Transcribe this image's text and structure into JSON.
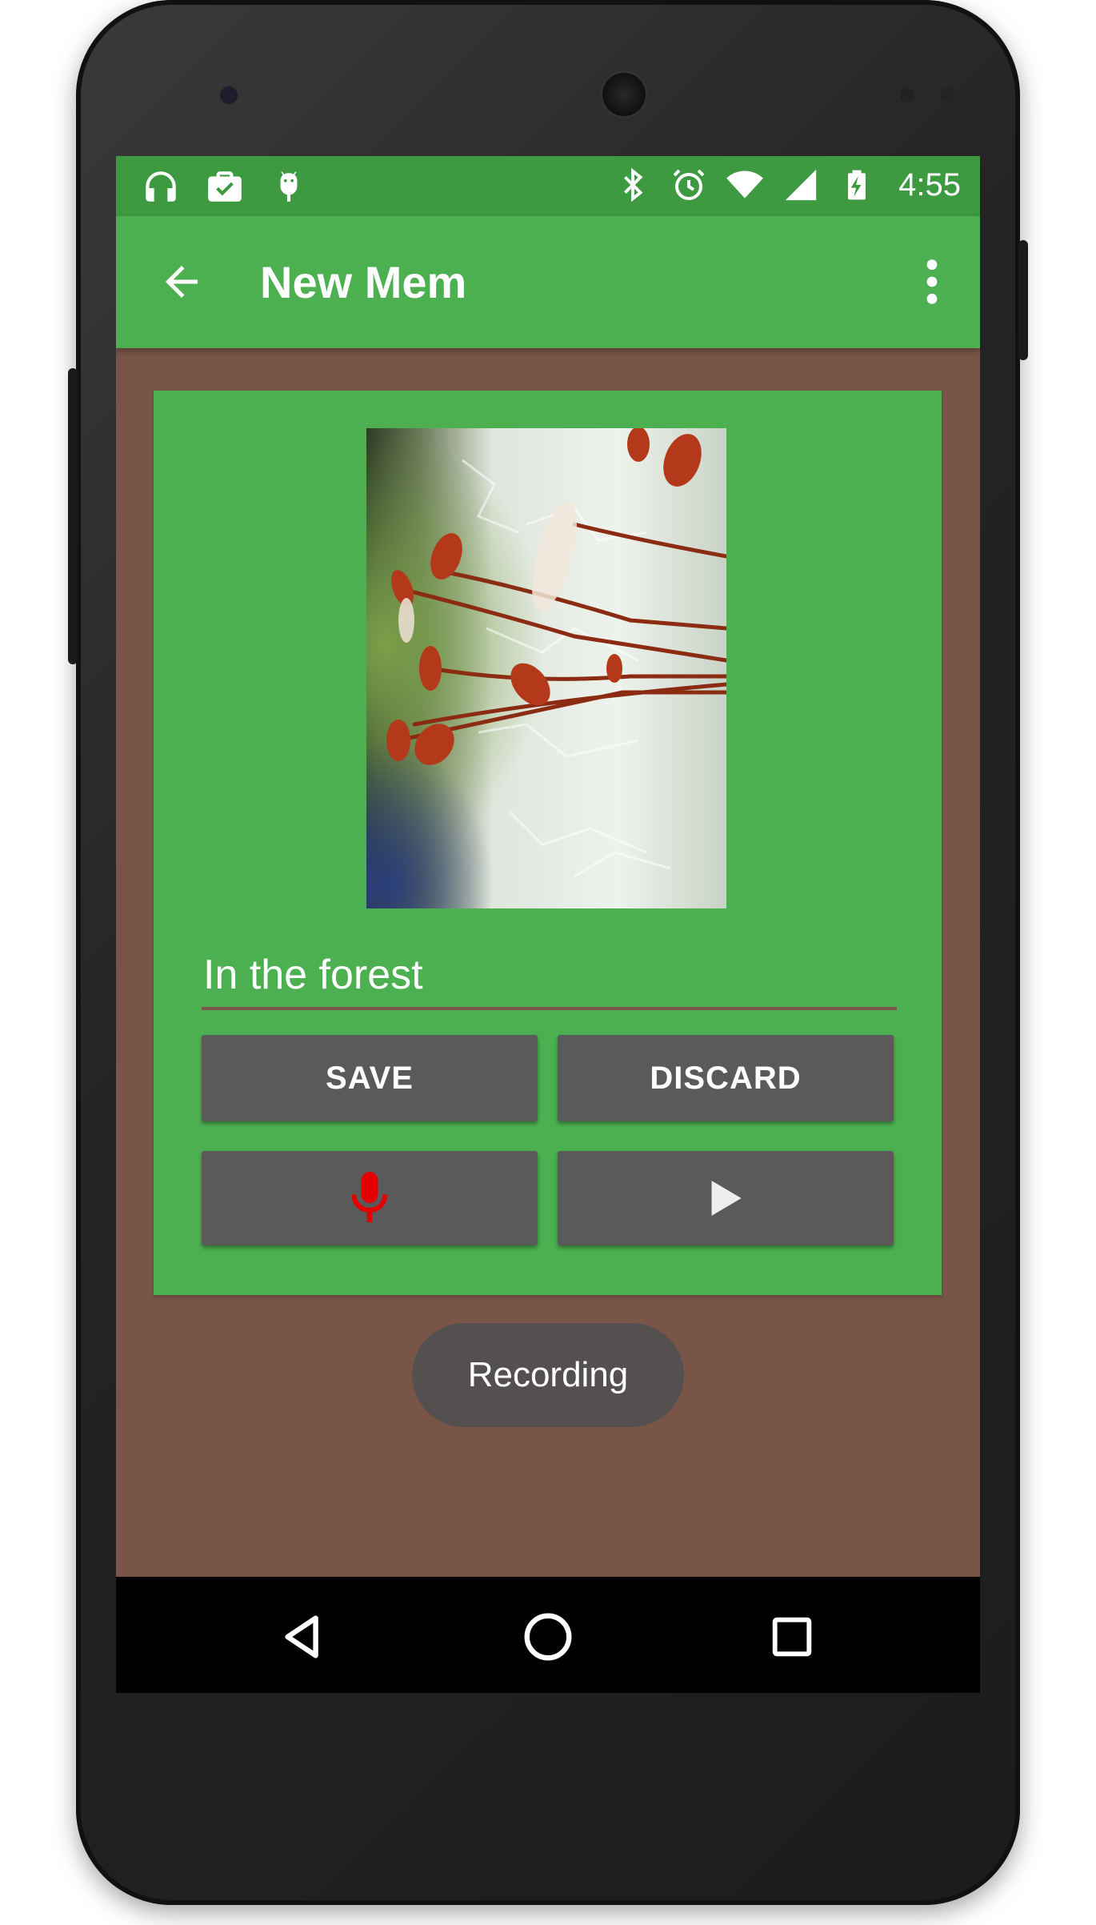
{
  "status_bar": {
    "time": "4:55",
    "left_icons": [
      "headphones-icon",
      "briefcase-check-icon",
      "android-icon"
    ],
    "right_icons": [
      "bluetooth-icon",
      "alarm-icon",
      "wifi-icon",
      "signal-icon",
      "battery-charging-icon"
    ]
  },
  "app_bar": {
    "title": "New Mem"
  },
  "form": {
    "title_value": "In the forest",
    "save_label": "SAVE",
    "discard_label": "DISCARD"
  },
  "toast": {
    "text": "Recording"
  },
  "colors": {
    "status_bar": "#3d9a41",
    "app_bar": "#4caf50",
    "background": "#795548",
    "card": "#4caf50",
    "button": "#5a5a5a",
    "mic_active": "#e50000"
  },
  "nav": {
    "icons": [
      "back-triangle-icon",
      "home-circle-icon",
      "recents-square-icon"
    ]
  }
}
